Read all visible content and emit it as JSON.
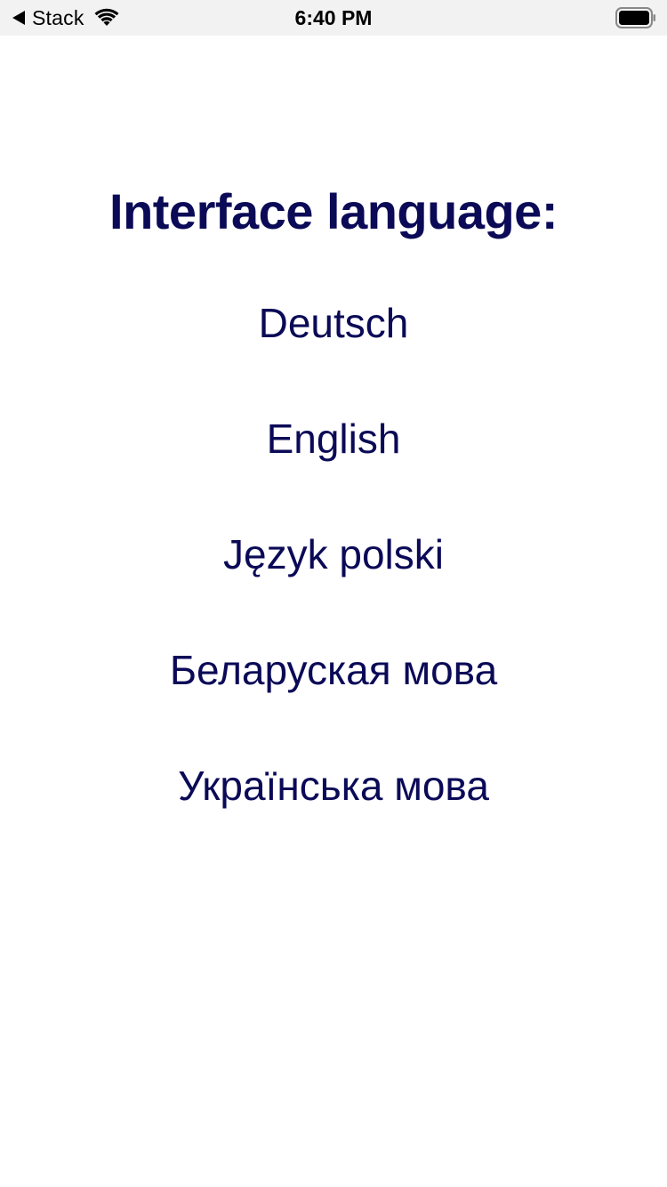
{
  "status_bar": {
    "back_icon": "back-triangle-icon",
    "back_app": "Stack",
    "wifi_icon": "wifi-icon",
    "time": "6:40 PM",
    "battery_icon": "battery-icon"
  },
  "screen": {
    "title": "Interface language:",
    "languages": [
      {
        "label": "Deutsch"
      },
      {
        "label": "English"
      },
      {
        "label": "Język polski"
      },
      {
        "label": "Беларуская мова"
      },
      {
        "label": "Українська мова"
      }
    ]
  },
  "colors": {
    "text_primary": "#0b0a57",
    "status_bar_bg": "#f2f2f2",
    "background": "#ffffff"
  }
}
